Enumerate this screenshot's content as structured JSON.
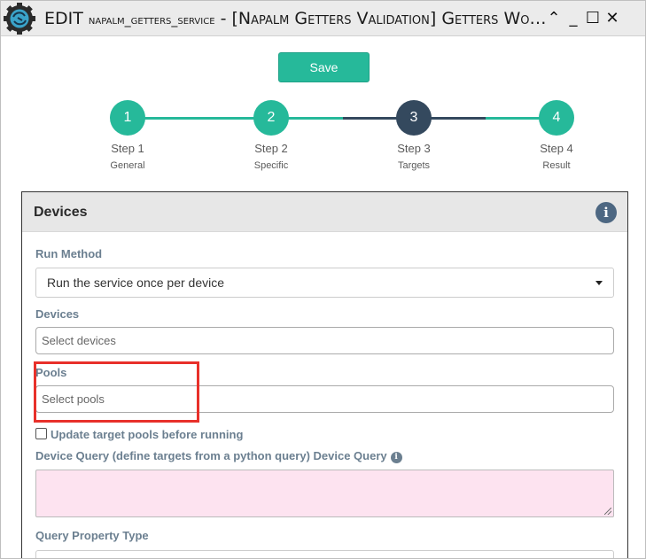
{
  "window": {
    "title_prefix": "EDIT ",
    "title_service": "napalm_getters_service",
    "title_rest": " - [Napalm Getters Validation] Getters Wo…",
    "controls": {
      "collapse": "⌃",
      "minimize": "_",
      "maximize": "☐",
      "close": "✕"
    }
  },
  "toolbar": {
    "save_label": "Save"
  },
  "steps": [
    {
      "number": "1",
      "label": "Step 1",
      "sub": "General",
      "state": "done"
    },
    {
      "number": "2",
      "label": "Step 2",
      "sub": "Specific",
      "state": "done"
    },
    {
      "number": "3",
      "label": "Step 3",
      "sub": "Targets",
      "state": "active"
    },
    {
      "number": "4",
      "label": "Step 4",
      "sub": "Result",
      "state": "done"
    }
  ],
  "colors": {
    "accent": "#26b99a",
    "active_step": "#34495e",
    "highlight": "#e8302a",
    "label": "#6b7f90"
  },
  "panel": {
    "title": "Devices",
    "info_icon": "info-icon",
    "run_method_label": "Run Method",
    "run_method_value": "Run the service once per device",
    "devices_label": "Devices",
    "devices_placeholder": "Select devices",
    "pools_label": "Pools",
    "pools_placeholder": "Select pools",
    "update_pools_label": "Update target pools before running",
    "update_pools_checked": false,
    "device_query_label": "Device Query (define targets from a python query) Device Query",
    "device_query_value": "",
    "query_property_label": "Query Property Type"
  }
}
